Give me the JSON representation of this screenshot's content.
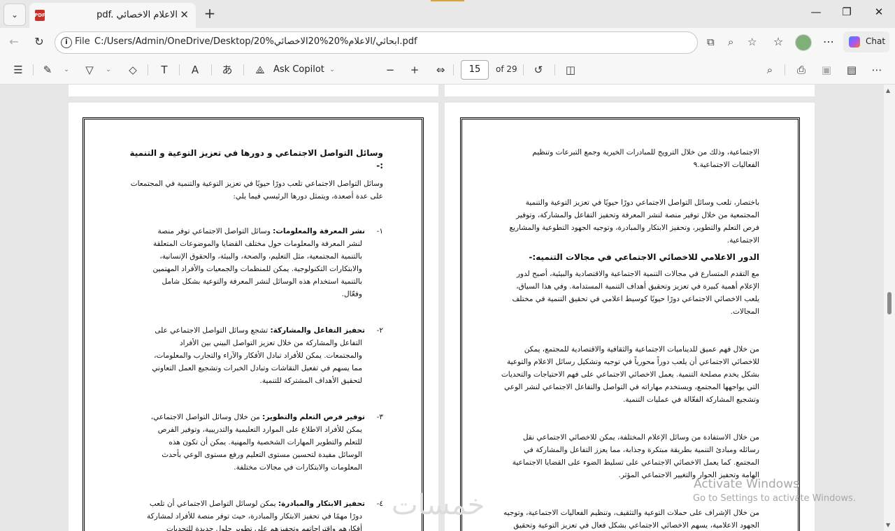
{
  "tab": {
    "title": "pdf. الاعلام الاخصائي",
    "pdf_badge": "PDF"
  },
  "window": {
    "minimize": "—",
    "maximize": "❐",
    "close": "✕",
    "tab_close": "✕",
    "new_tab": "+"
  },
  "address": {
    "file_label": "File",
    "url": "C:/Users/Admin/OneDrive/Desktop/ابحاثي/الاعلام%20%20الاخصائي%20.pdf"
  },
  "chat": {
    "label": "Chat"
  },
  "toolbar": {
    "ask_copilot": "Ask Copilot",
    "page_current": "15",
    "page_total": "of 29",
    "icons": [
      "contents-icon",
      "highlight-icon",
      "draw-icon",
      "eraser-icon",
      "text-box-icon",
      "read-aloud-icon",
      "translate-icon",
      "copilot-icon",
      "zoom-out-icon",
      "zoom-in-icon",
      "fit-width-icon",
      "rotate-icon",
      "page-view-icon",
      "search-icon",
      "print-icon",
      "save-icon",
      "save-as-icon",
      "more-icon"
    ]
  },
  "right_page": {
    "p1": "الاجتماعية، وذلك من خلال الترويج للمبادرات الخيرية وجمع التبرعات وتنظيم الفعاليات الاجتماعية.٩",
    "p2": "باختصار، تلعب وسائل التواصل الاجتماعي دورًا حيويًا في تعزيز التوعية والتنمية المجتمعية من خلال توفير منصة لنشر المعرفة وتحفيز التفاعل والمشاركة، وتوفير فرص التعلم والتطوير، وتحفيز الابتكار والمبادرة، وتوجيه الجهود التطوعية والمشاريع الاجتماعية.",
    "heading": "الدور الاعلامي للاخصائي الاجتماعي في مجالات التنميه:-",
    "p3": "مع التقدم المتسارع في مجالات التنمية الاجتماعية والاقتصادية والبيئية، أصبح لدور الإعلام أهمية كبيرة في تعزيز وتحقيق أهداف التنمية المستدامة. وفي هذا السياق، يلعب الاخصائي الاجتماعي دورًا حيويًا كوسيط اعلامي في تحقيق التنمية في مختلف المجالات.",
    "p4": "من خلال فهم عميق للديناميات الاجتماعية والثقافية والاقتصادية للمجتمع، يمكن للاخصائي الاجتماعي أن يلعب دوراً محورياً في توجيه وتشكيل رسائل الاعلام والتوعية بشكل يخدم مصلحة التنمية. يعمل الاخصائي الاجتماعي على فهم الاحتياجات والتحديات التي يواجهها المجتمع، ويستخدم مهاراته في التواصل والتفاعل الاجتماعي لنشر الوعي وتشجيع المشاركة الفعّالة في عمليات التنمية.",
    "p5": "من خلال الاستفادة من وسائل الإعلام المختلفة، يمكن للاخصائي الاجتماعي نقل رسائله ومبادئ التنمية بطريقة مبتكرة وجذابة، مما يعزز التفاعل والمشاركة في المجتمع. كما يعمل الاخصائي الاجتماعي على تسليط الضوء على القضايا الاجتماعية الهامة وتحفيز الحوار والتغيير الاجتماعي المؤثر.",
    "p6": "من خلال الإشراف على حملات التوعية والتثقيف، وتنظيم الفعاليات الاجتماعية، وتوجيه الجهود الاعلامية، يسهم الاخصائي الاجتماعي بشكل فعال في تعزيز التوعية وتحقيق"
  },
  "left_page": {
    "heading": "وسائل التواصل الاجتماعي و دورها في تعزيز التوعية و التنمية :-",
    "intro": "وسائل التواصل الاجتماعي تلعب دورًا حيويًا في تعزيز التوعية والتنمية في المجتمعات على عدة أصعدة، ويتمثل دورها الرئيسي فيما يلي:",
    "items": [
      {
        "num": "١-",
        "title": "نشر المعرفة والمعلومات:",
        "text": " وسائل التواصل الاجتماعي توفر منصة لنشر المعرفة والمعلومات حول مختلف القضايا والموضوعات المتعلقة بالتنمية المجتمعية، مثل التعليم، والصحة، والبيئة، والحقوق الإنسانية، والابتكارات التكنولوجية. يمكن للمنظمات والجمعيات والأفراد المهتمين بالتنمية استخدام هذه الوسائل لنشر المعرفة والتوعية بشكل شامل وفعّال."
      },
      {
        "num": "٢-",
        "title": "تحفيز التفاعل والمشاركة:",
        "text": " تشجع وسائل التواصل الاجتماعي على التفاعل والمشاركة من خلال تعزيز التواصل البيني بين الأفراد والمجتمعات. يمكن للأفراد تبادل الأفكار والآراء والتجارب والمعلومات، مما يسهم في تفعيل النقاشات وتبادل الخبرات وتشجيع العمل التعاوني لتحقيق الأهداف المشتركة للتنمية."
      },
      {
        "num": "٣-",
        "title": "توفير فرص التعلم والتطوير:",
        "text": " من خلال وسائل التواصل الاجتماعي، يمكن للأفراد الاطلاع على الموارد التعليمية والتدريبية، وتوفير الفرص للتعلم والتطوير المهارات الشخصية والمهنية. يمكن أن تكون هذه الوسائل مفيدة لتحسين مستوى التعليم ورفع مستوى الوعي بأحدث المعلومات والابتكارات في مجالات مختلفة."
      },
      {
        "num": "٤-",
        "title": "تحفيز الابتكار والمبادرة:",
        "text": " يمكن لوسائل التواصل الاجتماعي أن تلعب دورًا مهمًا في تحفيز الابتكار والمبادرة، حيث توفر منصة للأفراد لمشاركة أفكارهم واقتراحاتهم وتحفيزهم على تطوير حلول جديدة للتحديات المجتمعية."
      }
    ]
  },
  "watermark": {
    "title": "Activate Windows",
    "subtitle": "Go to Settings to activate Windows.",
    "logo_text": "خمسات"
  }
}
